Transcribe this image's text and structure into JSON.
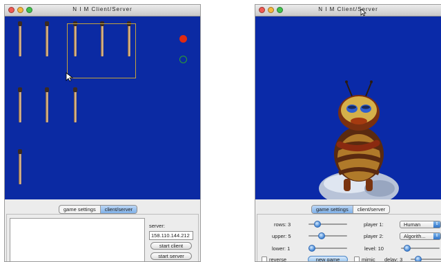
{
  "left_window": {
    "title": "N I M  Client/Server",
    "tabs": [
      {
        "label": "game settings",
        "active": false
      },
      {
        "label": "client/server",
        "active": true
      }
    ],
    "board": {
      "rows": [
        {
          "match_count": 5,
          "selected_count": 3
        },
        {
          "match_count": 3,
          "selected_count": 0
        },
        {
          "match_count": 1,
          "selected_count": 0
        }
      ],
      "current_player_marker": "filled-red-circle",
      "other_player_marker": "hollow-green-circle"
    },
    "client_server": {
      "server_label": "server:",
      "server_value": "158.110.144.212",
      "start_client_label": "start client",
      "start_server_label": "start server"
    }
  },
  "right_window": {
    "title": "N I M  Client/Server",
    "tabs": [
      {
        "label": "game settings",
        "active": true
      },
      {
        "label": "client/server",
        "active": false
      }
    ],
    "settings": {
      "rows_label": "rows: 3",
      "upper_label": "upper: 5",
      "lower_label": "lower: 1",
      "player1_label": "player 1:",
      "player1_value": "Human",
      "player2_label": "player 2:",
      "player2_value": "Algorith...",
      "level_label": "level: 10",
      "reverse_label": "reverse",
      "new_game_label": "new game",
      "mimic_label": "mimic",
      "delay_label": "delay: 3"
    },
    "scene_description_icon": "ladybug-mascot-icon"
  },
  "colors": {
    "board_blue": "#0b2aa3",
    "selection_gold": "#c6a43c",
    "marker_red": "#e02a10",
    "marker_green": "#2ea02e",
    "tab_active": "#7fb1ea"
  }
}
